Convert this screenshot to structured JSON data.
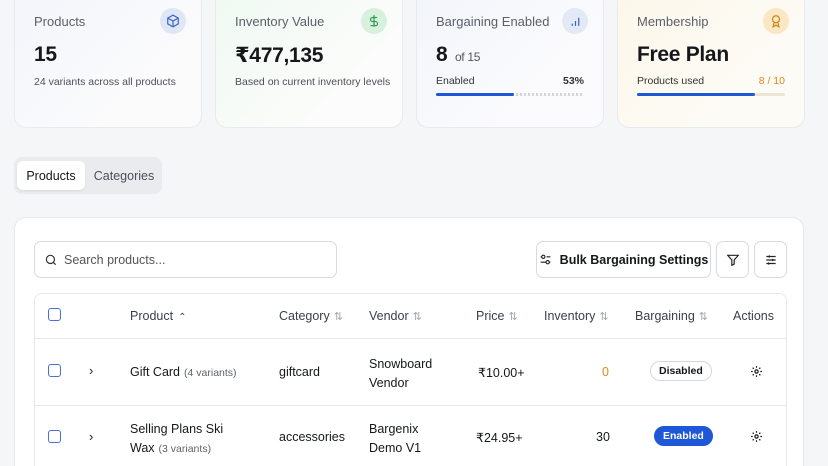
{
  "stats": {
    "products": {
      "label": "Products",
      "value": "15",
      "sub": "24 variants across all products"
    },
    "inventory": {
      "label": "Inventory Value",
      "value": "₹477,135",
      "sub": "Based on current inventory levels"
    },
    "bargaining": {
      "label": "Bargaining Enabled",
      "value": "8",
      "of": "of 15",
      "bar_label": "Enabled",
      "percent_text": "53%",
      "fraction": 0.53
    },
    "membership": {
      "label": "Membership",
      "value": "Free Plan",
      "bar_label": "Products used",
      "count_text": "8 / 10",
      "fraction": 0.8
    }
  },
  "tabs": [
    "Products",
    "Categories"
  ],
  "search": {
    "placeholder": "Search products..."
  },
  "toolbar": {
    "bulk_label": "Bulk Bargaining Settings"
  },
  "table": {
    "headers": [
      "Product",
      "Category",
      "Vendor",
      "Price",
      "Inventory",
      "Bargaining",
      "Actions"
    ],
    "rows": [
      {
        "name": "Gift Card",
        "variants": "(4 variants)",
        "category": "giftcard",
        "vendor_line1": "Snowboard",
        "vendor_line2": "Vendor",
        "price": "₹10.00+",
        "inventory": "0",
        "bargaining": "Disabled"
      },
      {
        "name_line1": "Selling Plans Ski",
        "name_line2": "Wax",
        "variants": "(3 variants)",
        "category": "accessories",
        "vendor_line1": "Bargenix",
        "vendor_line2": "Demo V1",
        "price": "₹24.95+",
        "inventory": "30",
        "bargaining": "Enabled"
      }
    ]
  },
  "colors": {
    "accent": "#1f58d6",
    "warning": "#e08a12"
  }
}
